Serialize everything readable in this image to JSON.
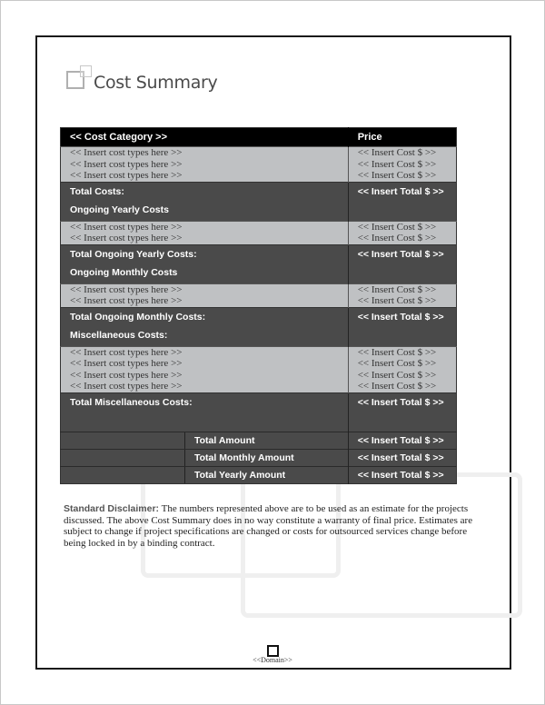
{
  "title": "Cost Summary",
  "table": {
    "header": {
      "category": "<< Cost Category >>",
      "price": "Price"
    },
    "sections": [
      {
        "items": [
          {
            "label": "<< Insert cost types here >>",
            "price": "<< Insert Cost $ >>"
          },
          {
            "label": "<< Insert cost types here >>",
            "price": "<< Insert Cost $ >>"
          },
          {
            "label": "<< Insert cost types here >>",
            "price": "<< Insert Cost $ >>"
          }
        ],
        "total_label": "Total Costs:",
        "total_value": "<< Insert Total $ >>",
        "next_heading": "Ongoing Yearly Costs"
      },
      {
        "items": [
          {
            "label": "<< Insert cost types here >>",
            "price": "<< Insert Cost $ >>"
          },
          {
            "label": "<< Insert cost types here >>",
            "price": "<< Insert Cost $ >>"
          }
        ],
        "total_label": "Total Ongoing Yearly Costs:",
        "total_value": "<< Insert Total $ >>",
        "next_heading": "Ongoing Monthly Costs"
      },
      {
        "items": [
          {
            "label": "<< Insert cost types here >>",
            "price": "<< Insert Cost $ >>"
          },
          {
            "label": "<< Insert cost types here >>",
            "price": "<< Insert Cost $ >>"
          }
        ],
        "total_label": "Total Ongoing Monthly Costs:",
        "total_value": "<< Insert Total $ >>",
        "next_heading": "Miscellaneous Costs:"
      },
      {
        "items": [
          {
            "label": "<< Insert cost types here >>",
            "price": "<< Insert Cost $ >>"
          },
          {
            "label": "<< Insert cost types here >>",
            "price": "<< Insert Cost $ >>"
          },
          {
            "label": "<< Insert cost types here >>",
            "price": "<< Insert Cost $ >>"
          },
          {
            "label": "<< Insert cost types here >>",
            "price": "<< Insert Cost $ >>"
          }
        ],
        "total_label": "Total Miscellaneous Costs:",
        "total_value": "<< Insert Total $ >>",
        "next_heading": ""
      }
    ],
    "summary": [
      {
        "label": "Total Amount",
        "value": "<< Insert Total $ >>"
      },
      {
        "label": "Total Monthly Amount",
        "value": "<< Insert Total $ >>"
      },
      {
        "label": "Total Yearly Amount",
        "value": "<< Insert Total $ >>"
      }
    ]
  },
  "disclaimer": {
    "lead": "Standard Disclaimer:",
    "text": " The numbers represented above are to be used as an estimate for the projects discussed. The above Cost Summary does in no way constitute a warranty of final price.  Estimates are subject to change if project specifications are changed or costs for outsourced services change before being locked in by a binding contract."
  },
  "footer": {
    "domain": "<<Domain>>"
  },
  "colors": {
    "header_bg": "#000000",
    "item_bg": "#bfc1c3",
    "total_bg": "#4a4a4a"
  }
}
